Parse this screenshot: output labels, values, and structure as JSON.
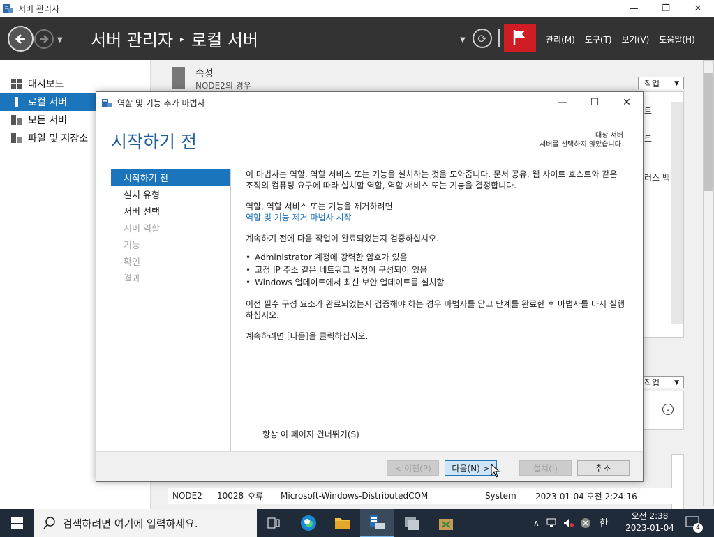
{
  "window": {
    "title": "서버 관리자",
    "controls": {
      "minimize": "—",
      "restore": "❐",
      "close": "✕"
    }
  },
  "header": {
    "breadcrumb_root": "서버 관리자",
    "breadcrumb_sep": "▸",
    "breadcrumb_current": "로컬 서버",
    "menus": [
      "관리(M)",
      "도구(T)",
      "보기(V)",
      "도움말(H)"
    ]
  },
  "sidebar": {
    "items": [
      {
        "label": "대시보드",
        "icon": "dashboard-icon",
        "active": false
      },
      {
        "label": "로컬 서버",
        "icon": "local-server-icon",
        "active": true
      },
      {
        "label": "모든 서버",
        "icon": "all-servers-icon",
        "active": false
      },
      {
        "label": "파일 및 저장소",
        "icon": "file-storage-icon",
        "active": false
      }
    ]
  },
  "main": {
    "properties_title": "속성",
    "properties_subtitle": "NODE2의 경우",
    "task_label": "작업",
    "task_label2": "작업",
    "partial_right_1": "트",
    "partial_right_2": "트",
    "partial_right_3": "러스 백",
    "event_row": {
      "server": "NODE2",
      "id": "10028",
      "severity": "오류",
      "source": "Microsoft-Windows-DistributedCOM",
      "log": "System",
      "datetime": "2023-01-04 오전 2:24:16"
    }
  },
  "wizard": {
    "title": "역할 및 기능 추가 마법사",
    "heading": "시작하기 전",
    "destination_label": "대상 서버",
    "destination_value": "서버를 선택하지 않았습니다.",
    "steps": [
      {
        "label": "시작하기 전",
        "state": "current"
      },
      {
        "label": "설치 유형",
        "state": "enabled"
      },
      {
        "label": "서버 선택",
        "state": "enabled"
      },
      {
        "label": "서버 역할",
        "state": "disabled"
      },
      {
        "label": "기능",
        "state": "disabled"
      },
      {
        "label": "확인",
        "state": "disabled"
      },
      {
        "label": "결과",
        "state": "disabled"
      }
    ],
    "intro": "이 마법사는 역할, 역할 서비스 또는 기능을 설치하는 것을 도와줍니다. 문서 공유, 웹 사이트 호스트와 같은 조직의 컴퓨팅 요구에 따라 설치할 역할, 역할 서비스 또는 기능을 결정합니다.",
    "remove_text": "역할, 역할 서비스 또는 기능을 제거하려면",
    "remove_link": "역할 및 기능 제거 마법사 시작",
    "verify_text": "계속하기 전에 다음 작업이 완료되었는지 검증하십시오.",
    "bullets": [
      "Administrator 계정에 강력한 암호가 있음",
      "고정 IP 주소 같은 네트워크 설정이 구성되어 있음",
      "Windows 업데이트에서 최신 보안 업데이트를 설치함"
    ],
    "close_text": "이전 필수 구성 요소가 완료되었는지 검증해야 하는 경우 마법사를 닫고 단계를 완료한 후 마법사를 다시 실행하십시오.",
    "continue_text": "계속하려면 [다음]을 클릭하십시오.",
    "skip_label": "항상 이 페이지 건너뛰기(S)",
    "buttons": {
      "previous": "< 이전(P)",
      "next": "다음(N) >",
      "install": "설치(I)",
      "cancel": "취소"
    }
  },
  "taskbar": {
    "search_placeholder": "검색하려면 여기에 입력하세요.",
    "ime": "한",
    "time": "오전 2:38",
    "date": "2023-01-04",
    "notification_count": "4"
  },
  "colors": {
    "accent": "#1a75bc",
    "header_bg": "#333333",
    "flag_red": "#d01c25",
    "taskbar_bg": "#1f2b38"
  }
}
